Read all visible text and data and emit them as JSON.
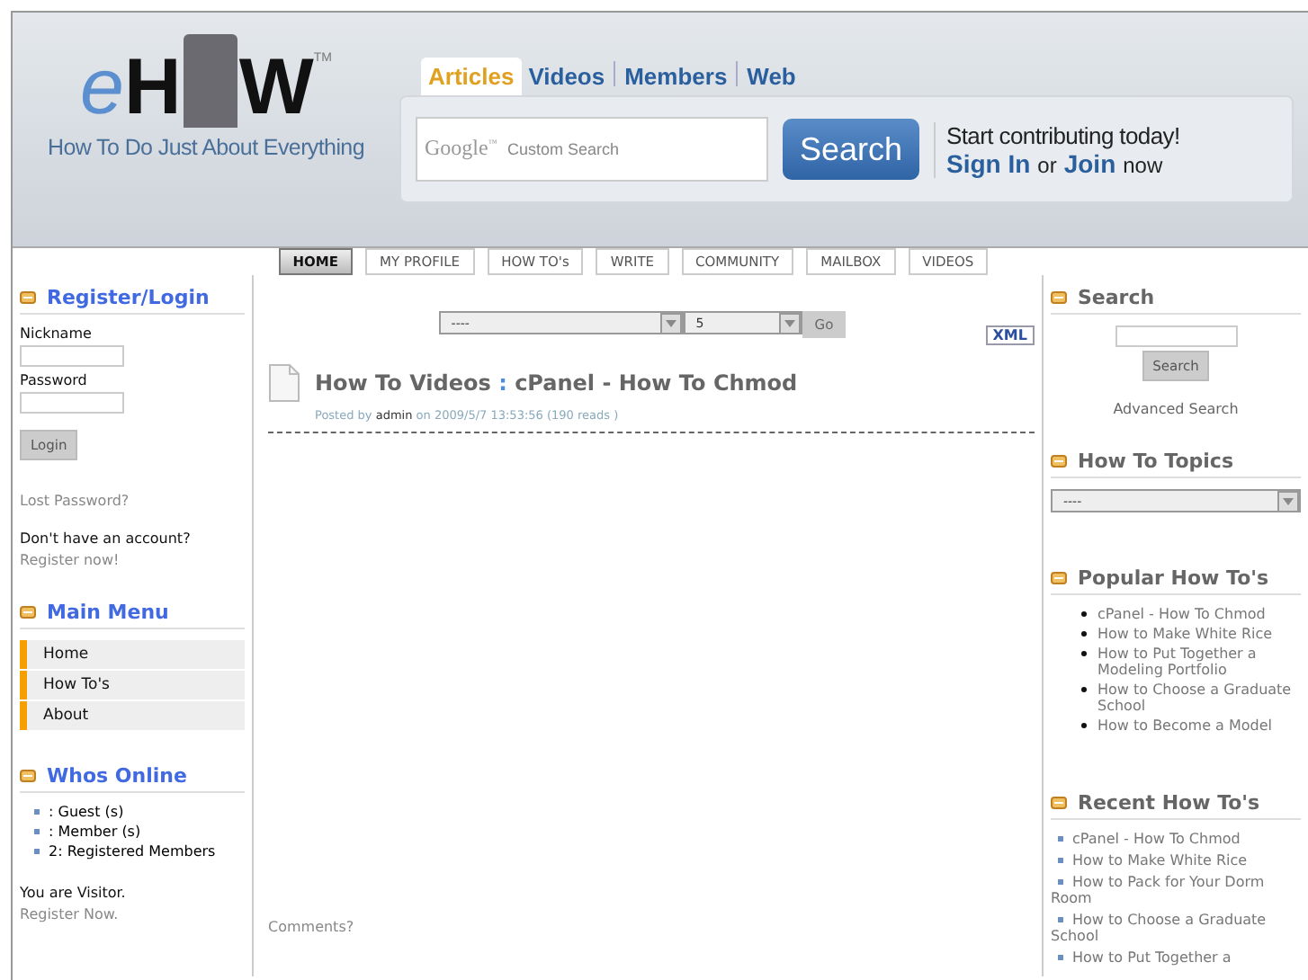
{
  "header": {
    "logo": {
      "e": "e",
      "h": "H",
      "w": "W",
      "mark": "TM",
      "tagline": "How To Do Just About Everything"
    },
    "search_tabs": [
      {
        "label": "Articles",
        "selected": true
      },
      {
        "label": "Videos",
        "selected": false
      },
      {
        "label": "Members",
        "selected": false
      },
      {
        "label": "Web",
        "selected": false
      }
    ],
    "search": {
      "brand": "Google",
      "brand_mark": "™",
      "placeholder": "Custom Search",
      "button": "Search"
    },
    "promo": {
      "text": "Start contributing today!",
      "sign_in": "Sign In",
      "or": "or",
      "join": "Join",
      "now": "now"
    }
  },
  "nav": [
    {
      "label": "HOME",
      "selected": true
    },
    {
      "label": "MY PROFILE",
      "selected": false
    },
    {
      "label": "HOW TO's",
      "selected": false
    },
    {
      "label": "WRITE",
      "selected": false
    },
    {
      "label": "COMMUNITY",
      "selected": false
    },
    {
      "label": "MAILBOX",
      "selected": false
    },
    {
      "label": "VIDEOS",
      "selected": false
    }
  ],
  "left": {
    "login": {
      "title": "Register/Login",
      "nickname_label": "Nickname",
      "password_label": "Password",
      "button": "Login",
      "lost": "Lost Password?",
      "no_account": "Don't have an account?",
      "register": "Register now!"
    },
    "main_menu": {
      "title": "Main Menu",
      "items": [
        "Home",
        "How To's",
        "About"
      ]
    },
    "whos_online": {
      "title": "Whos Online",
      "items": [
        ": Guest (s)",
        ": Member (s)",
        "2: Registered Members"
      ],
      "visitor": "You are Visitor.",
      "register": "Register Now."
    }
  },
  "center": {
    "filter": {
      "category": "----",
      "count": "5",
      "button": "Go"
    },
    "xml": "XML",
    "article": {
      "category": "How To Videos",
      "separator": ":",
      "title": "cPanel - How To Chmod",
      "posted_by": "Posted by",
      "author": "admin",
      "on": "on 2009/5/7 13:53:56 (190 reads )"
    },
    "comments": "Comments?"
  },
  "right": {
    "search": {
      "title": "Search",
      "button": "Search",
      "advanced": "Advanced Search"
    },
    "topics": {
      "title": "How To Topics",
      "value": "----"
    },
    "popular": {
      "title": "Popular How To's",
      "items": [
        "cPanel - How To Chmod",
        "How to Make White Rice",
        "How to Put Together a Modeling Portfolio",
        "How to Choose a Graduate School",
        "How to Become a Model"
      ]
    },
    "recent": {
      "title": "Recent How To's",
      "items": [
        "cPanel - How To Chmod",
        "How to Make White Rice",
        "How to Pack for Your Dorm Room",
        "How to Choose a Graduate School",
        "How to Put Together a"
      ]
    }
  }
}
